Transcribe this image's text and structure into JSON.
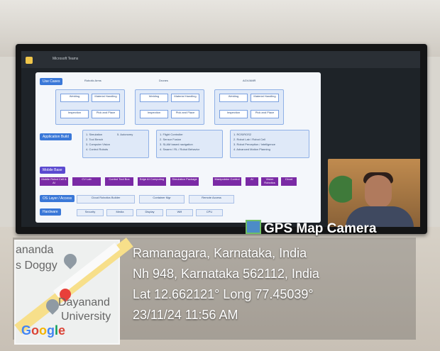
{
  "screen": {
    "app_title": "Microsoft Teams",
    "slide": {
      "top_left_tag": "Use Cases",
      "labs": [
        "Robotic Arms",
        "Drones",
        "AGV/AMR"
      ],
      "row1": [
        [
          "Welding",
          "Material Handling"
        ],
        [
          "Welding",
          "Material Handling"
        ],
        [
          "Welding",
          "Material Handling"
        ]
      ],
      "row2": [
        [
          "Inspection",
          "Pick and Place"
        ],
        [
          "Inspection",
          "Pick and Place"
        ],
        [
          "Inspection",
          "Pick and Place"
        ]
      ],
      "apps_tag": "Application Build",
      "apps_left": [
        "1. Simulation",
        "2. Tool Bench",
        "3. Computer Vision",
        "4. Control Robots",
        "5. Autonomy"
      ],
      "apps_mid": [
        "1. Flight Controller",
        "2. Sensor Fusion",
        "3. SLAM based navigation",
        "4. Swarm / RL / Robot Behavior"
      ],
      "apps_right": [
        "1. ROS/ROS2",
        "2. Robot Lab / Robot Cell",
        "3. Robot Perception / Intelligence",
        "4. Advanced Motion Planning"
      ],
      "mobile_tag": "Mobile Base",
      "purple_items": [
        "Mobile Robot Cell & AI",
        "CV Lab",
        "Control Tool Box",
        "Edge AI Computing",
        "Simulation Package",
        "Manipulator Control",
        "AI",
        "Vision Robotics",
        "Cloud"
      ],
      "llm_tag": "OS Layer / Access",
      "light_items": [
        "Cloud Robotics Builder",
        "Container Mgr",
        "Remote Access"
      ],
      "hardware_tag": "Hardware",
      "hardware_items": [
        "Security",
        "Media",
        "Display",
        "Wifi",
        "CPU"
      ]
    },
    "gps_overlay": {
      "title": "GPS Map Camera",
      "location_line_1": "Ramanagara, Karnataka, India",
      "location_line_2": "Nh 948, Karnataka 562112, India",
      "coordinates": "Lat 12.662121° Long 77.45039°",
      "timestamp": "23/11/24 11:56 AM"
    },
    "map": {
      "labels": [
        "ananda",
        "s Doggy",
        "Dayanand",
        "University"
      ],
      "google_text": [
        "G",
        "o",
        "o",
        "g",
        "l",
        "e"
      ]
    }
  },
  "colors": {
    "accent": "#3a78d8",
    "purple": "#7a2aa5",
    "map_road": "#f7df8a"
  }
}
